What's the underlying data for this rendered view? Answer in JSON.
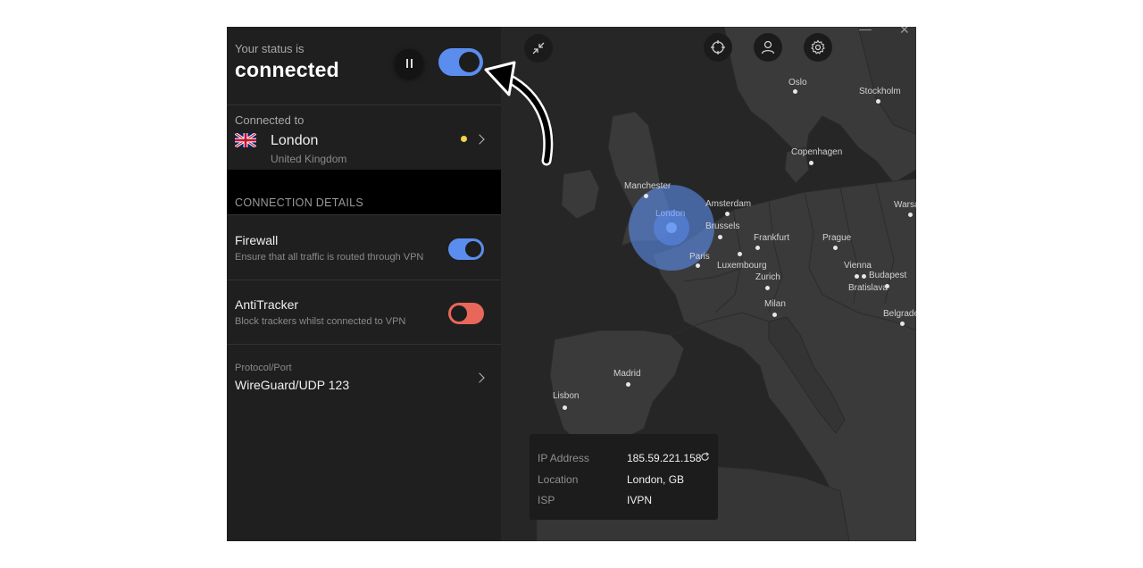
{
  "status": {
    "label": "Your status is",
    "value": "connected"
  },
  "connection": {
    "label": "Connected to",
    "city": "London",
    "country": "United Kingdom"
  },
  "details": {
    "title": "CONNECTION DETAILS",
    "firewall": {
      "title": "Firewall",
      "description": "Ensure that all traffic is routed through VPN"
    },
    "antitracker": {
      "title": "AntiTracker",
      "description": "Block trackers whilst connected to VPN"
    },
    "protocol": {
      "label": "Protocol/Port",
      "value": "WireGuard/UDP 123"
    }
  },
  "map": {
    "cities": [
      {
        "name": "Oslo"
      },
      {
        "name": "Stockholm"
      },
      {
        "name": "Copenhagen"
      },
      {
        "name": "Manchester"
      },
      {
        "name": "London"
      },
      {
        "name": "Amsterdam"
      },
      {
        "name": "Brussels"
      },
      {
        "name": "Warsaw"
      },
      {
        "name": "Frankfurt"
      },
      {
        "name": "Prague"
      },
      {
        "name": "Paris"
      },
      {
        "name": "Luxembourg"
      },
      {
        "name": "Zurich"
      },
      {
        "name": "Vienna"
      },
      {
        "name": "Budapest"
      },
      {
        "name": "Bratislava"
      },
      {
        "name": "Milan"
      },
      {
        "name": "Belgrade"
      },
      {
        "name": "Madrid"
      },
      {
        "name": "Lisbon"
      }
    ]
  },
  "info": {
    "ip_label": "IP Address",
    "ip_value": "185.59.221.158",
    "location_label": "Location",
    "location_value": "London, GB",
    "isp_label": "ISP",
    "isp_value": "IVPN"
  },
  "colors": {
    "accent": "#5b8dee",
    "danger": "#e8675a",
    "load_indicator": "#f2d34e"
  },
  "toggles": {
    "connection_on": true,
    "firewall_on": true,
    "antitracker_on": false
  }
}
